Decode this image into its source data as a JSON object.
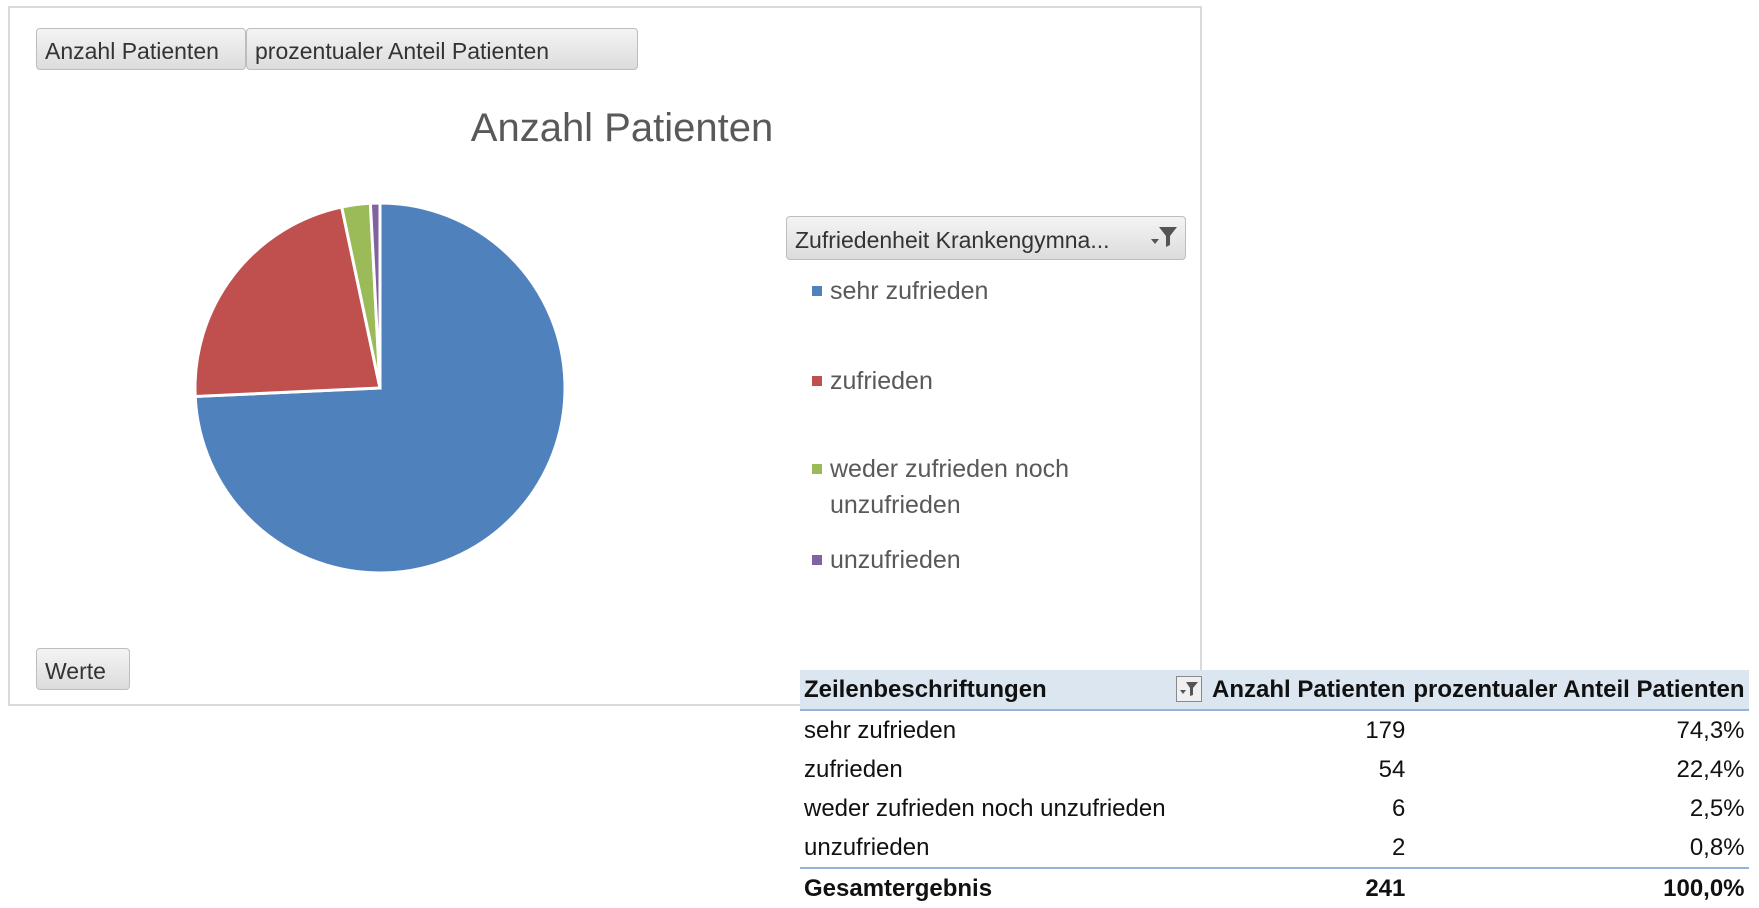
{
  "pivot_buttons": {
    "count": "Anzahl Patienten",
    "percent": "prozentualer Anteil Patienten",
    "values": "Werte"
  },
  "legend": {
    "field": "Zufriedenheit Krankengymna...",
    "items": [
      {
        "label": "sehr zufrieden",
        "color": "#4f81bd"
      },
      {
        "label": "zufrieden",
        "color": "#c0504d"
      },
      {
        "label": "weder zufrieden noch unzufrieden",
        "color": "#9bbb59"
      },
      {
        "label": "unzufrieden",
        "color": "#8064a2"
      }
    ]
  },
  "chart_data": {
    "type": "pie",
    "title": "Anzahl Patienten",
    "categories": [
      "sehr zufrieden",
      "zufrieden",
      "weder zufrieden noch unzufrieden",
      "unzufrieden"
    ],
    "values": [
      179,
      54,
      6,
      2
    ],
    "colors": [
      "#4f81bd",
      "#c0504d",
      "#9bbb59",
      "#8064a2"
    ],
    "legend_position": "right"
  },
  "table": {
    "headers": [
      "Zeilenbeschriftungen",
      "Anzahl Patienten",
      "prozentualer Anteil Patienten"
    ],
    "rows": [
      {
        "label": "sehr zufrieden",
        "count": "179",
        "percent": "74,3%"
      },
      {
        "label": "zufrieden",
        "count": "54",
        "percent": "22,4%"
      },
      {
        "label": "weder zufrieden noch unzufrieden",
        "count": "6",
        "percent": "2,5%"
      },
      {
        "label": "unzufrieden",
        "count": "2",
        "percent": "0,8%"
      }
    ],
    "total": {
      "label": "Gesamtergebnis",
      "count": "241",
      "percent": "100,0%"
    }
  }
}
